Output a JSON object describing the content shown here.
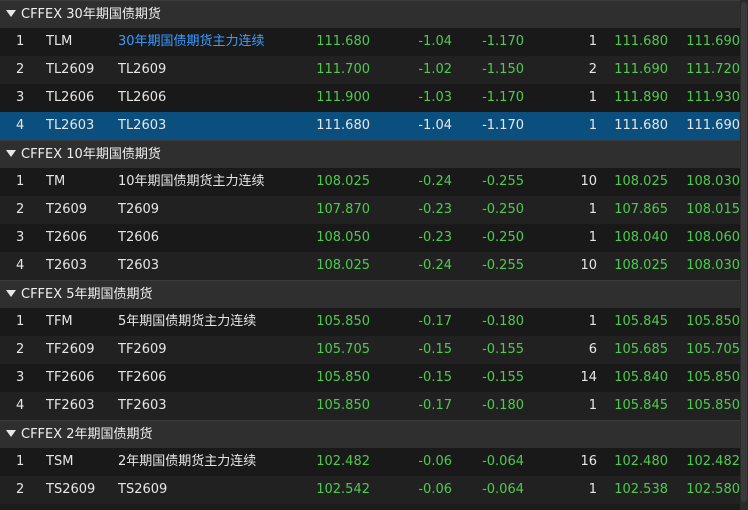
{
  "colors": {
    "up_green": "#4ecb4e",
    "selected_row": "#0b4f7e",
    "link_blue": "#3b9cff"
  },
  "groups": [
    {
      "title": "CFFEX 30年期国债期货",
      "rows": [
        {
          "idx": "1",
          "code": "TLM",
          "name": "30年期国债期货主力连续",
          "price": "111.680",
          "chg": "-1.04",
          "pct": "-1.170",
          "vol": "1",
          "bid": "111.680",
          "ask": "111.690"
        },
        {
          "idx": "2",
          "code": "TL2609",
          "name": "TL2609",
          "price": "111.700",
          "chg": "-1.02",
          "pct": "-1.150",
          "vol": "2",
          "bid": "111.690",
          "ask": "111.720"
        },
        {
          "idx": "3",
          "code": "TL2606",
          "name": "TL2606",
          "price": "111.900",
          "chg": "-1.03",
          "pct": "-1.170",
          "vol": "1",
          "bid": "111.890",
          "ask": "111.930"
        },
        {
          "idx": "4",
          "code": "TL2603",
          "name": "TL2603",
          "price": "111.680",
          "chg": "-1.04",
          "pct": "-1.170",
          "vol": "1",
          "bid": "111.680",
          "ask": "111.690"
        }
      ]
    },
    {
      "title": "CFFEX 10年期国债期货",
      "rows": [
        {
          "idx": "1",
          "code": "TM",
          "name": "10年期国债期货主力连续",
          "price": "108.025",
          "chg": "-0.24",
          "pct": "-0.255",
          "vol": "10",
          "bid": "108.025",
          "ask": "108.030"
        },
        {
          "idx": "2",
          "code": "T2609",
          "name": "T2609",
          "price": "107.870",
          "chg": "-0.23",
          "pct": "-0.250",
          "vol": "1",
          "bid": "107.865",
          "ask": "108.015"
        },
        {
          "idx": "3",
          "code": "T2606",
          "name": "T2606",
          "price": "108.050",
          "chg": "-0.23",
          "pct": "-0.250",
          "vol": "1",
          "bid": "108.040",
          "ask": "108.060"
        },
        {
          "idx": "4",
          "code": "T2603",
          "name": "T2603",
          "price": "108.025",
          "chg": "-0.24",
          "pct": "-0.255",
          "vol": "10",
          "bid": "108.025",
          "ask": "108.030"
        }
      ]
    },
    {
      "title": "CFFEX 5年期国债期货",
      "rows": [
        {
          "idx": "1",
          "code": "TFM",
          "name": "5年期国债期货主力连续",
          "price": "105.850",
          "chg": "-0.17",
          "pct": "-0.180",
          "vol": "1",
          "bid": "105.845",
          "ask": "105.850"
        },
        {
          "idx": "2",
          "code": "TF2609",
          "name": "TF2609",
          "price": "105.705",
          "chg": "-0.15",
          "pct": "-0.155",
          "vol": "6",
          "bid": "105.685",
          "ask": "105.705"
        },
        {
          "idx": "3",
          "code": "TF2606",
          "name": "TF2606",
          "price": "105.850",
          "chg": "-0.15",
          "pct": "-0.155",
          "vol": "14",
          "bid": "105.840",
          "ask": "105.850"
        },
        {
          "idx": "4",
          "code": "TF2603",
          "name": "TF2603",
          "price": "105.850",
          "chg": "-0.17",
          "pct": "-0.180",
          "vol": "1",
          "bid": "105.845",
          "ask": "105.850"
        }
      ]
    },
    {
      "title": "CFFEX 2年期国债期货",
      "rows": [
        {
          "idx": "1",
          "code": "TSM",
          "name": "2年期国债期货主力连续",
          "price": "102.482",
          "chg": "-0.06",
          "pct": "-0.064",
          "vol": "16",
          "bid": "102.480",
          "ask": "102.482"
        },
        {
          "idx": "2",
          "code": "TS2609",
          "name": "TS2609",
          "price": "102.542",
          "chg": "-0.06",
          "pct": "-0.064",
          "vol": "1",
          "bid": "102.538",
          "ask": "102.580"
        }
      ]
    }
  ]
}
